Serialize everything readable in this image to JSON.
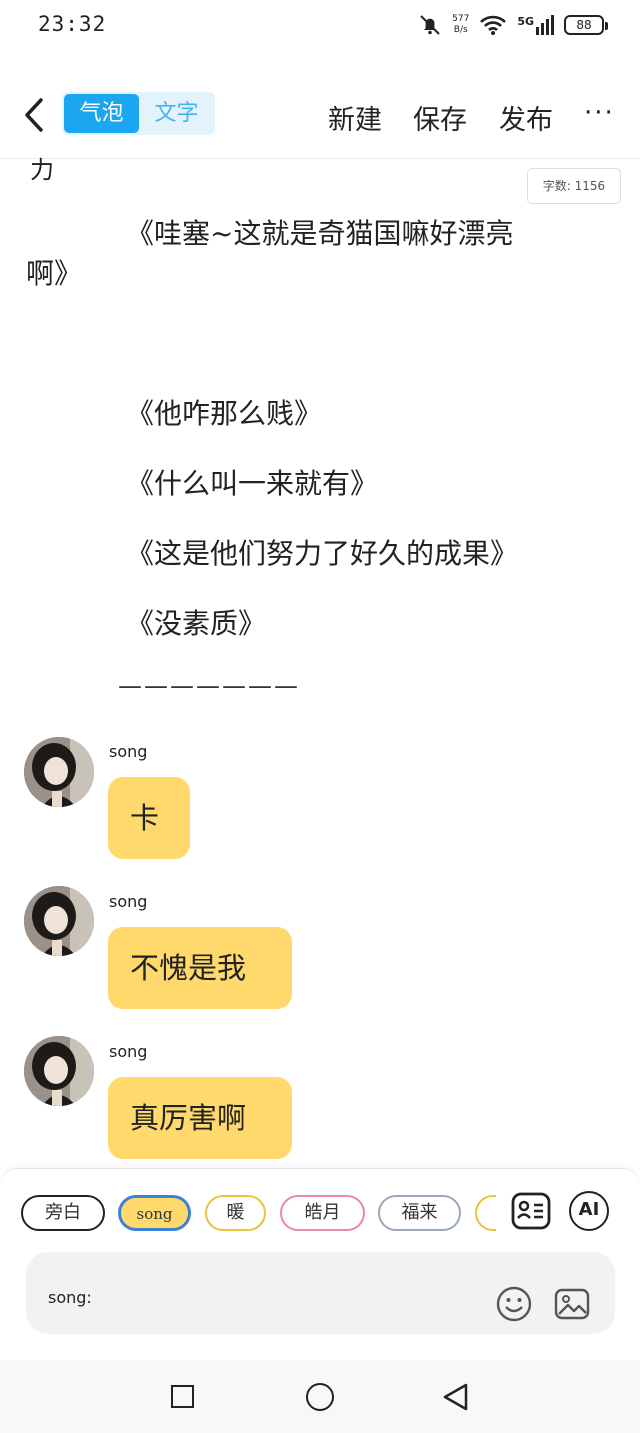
{
  "status": {
    "time": "23:32",
    "net_speed_value": "577",
    "net_speed_unit": "B/s",
    "network": "5G",
    "battery": "88"
  },
  "header": {
    "seg_bubble": "气泡",
    "seg_text": "文字",
    "new_label": "新建",
    "save_label": "保存",
    "publish_label": "发布",
    "more_label": "···"
  },
  "content": {
    "fragment": "力",
    "word_count": "字数: 1156",
    "lines": [
      "《哇塞~这就是奇猫国嘛好漂亮",
      "啊》",
      "《他咋那么贱》",
      "《什么叫一来就有》",
      "《这是他们努力了好久的成果》",
      "《没素质》"
    ],
    "dashes": "———————"
  },
  "messages": [
    {
      "sender": "song",
      "text": "卡"
    },
    {
      "sender": "song",
      "text": "不愧是我"
    },
    {
      "sender": "song",
      "text": "真厉害啊"
    }
  ],
  "chips": [
    {
      "label": "旁白",
      "color": "#222222"
    },
    {
      "label": "song",
      "color": "#3b82d6"
    },
    {
      "label": "暖",
      "color": "#e9c33a"
    },
    {
      "label": "皓月",
      "color": "#e88aa6"
    },
    {
      "label": "福来",
      "color": "#9aa8b8"
    }
  ],
  "ai_label": "AI",
  "input": {
    "label": "song:"
  }
}
